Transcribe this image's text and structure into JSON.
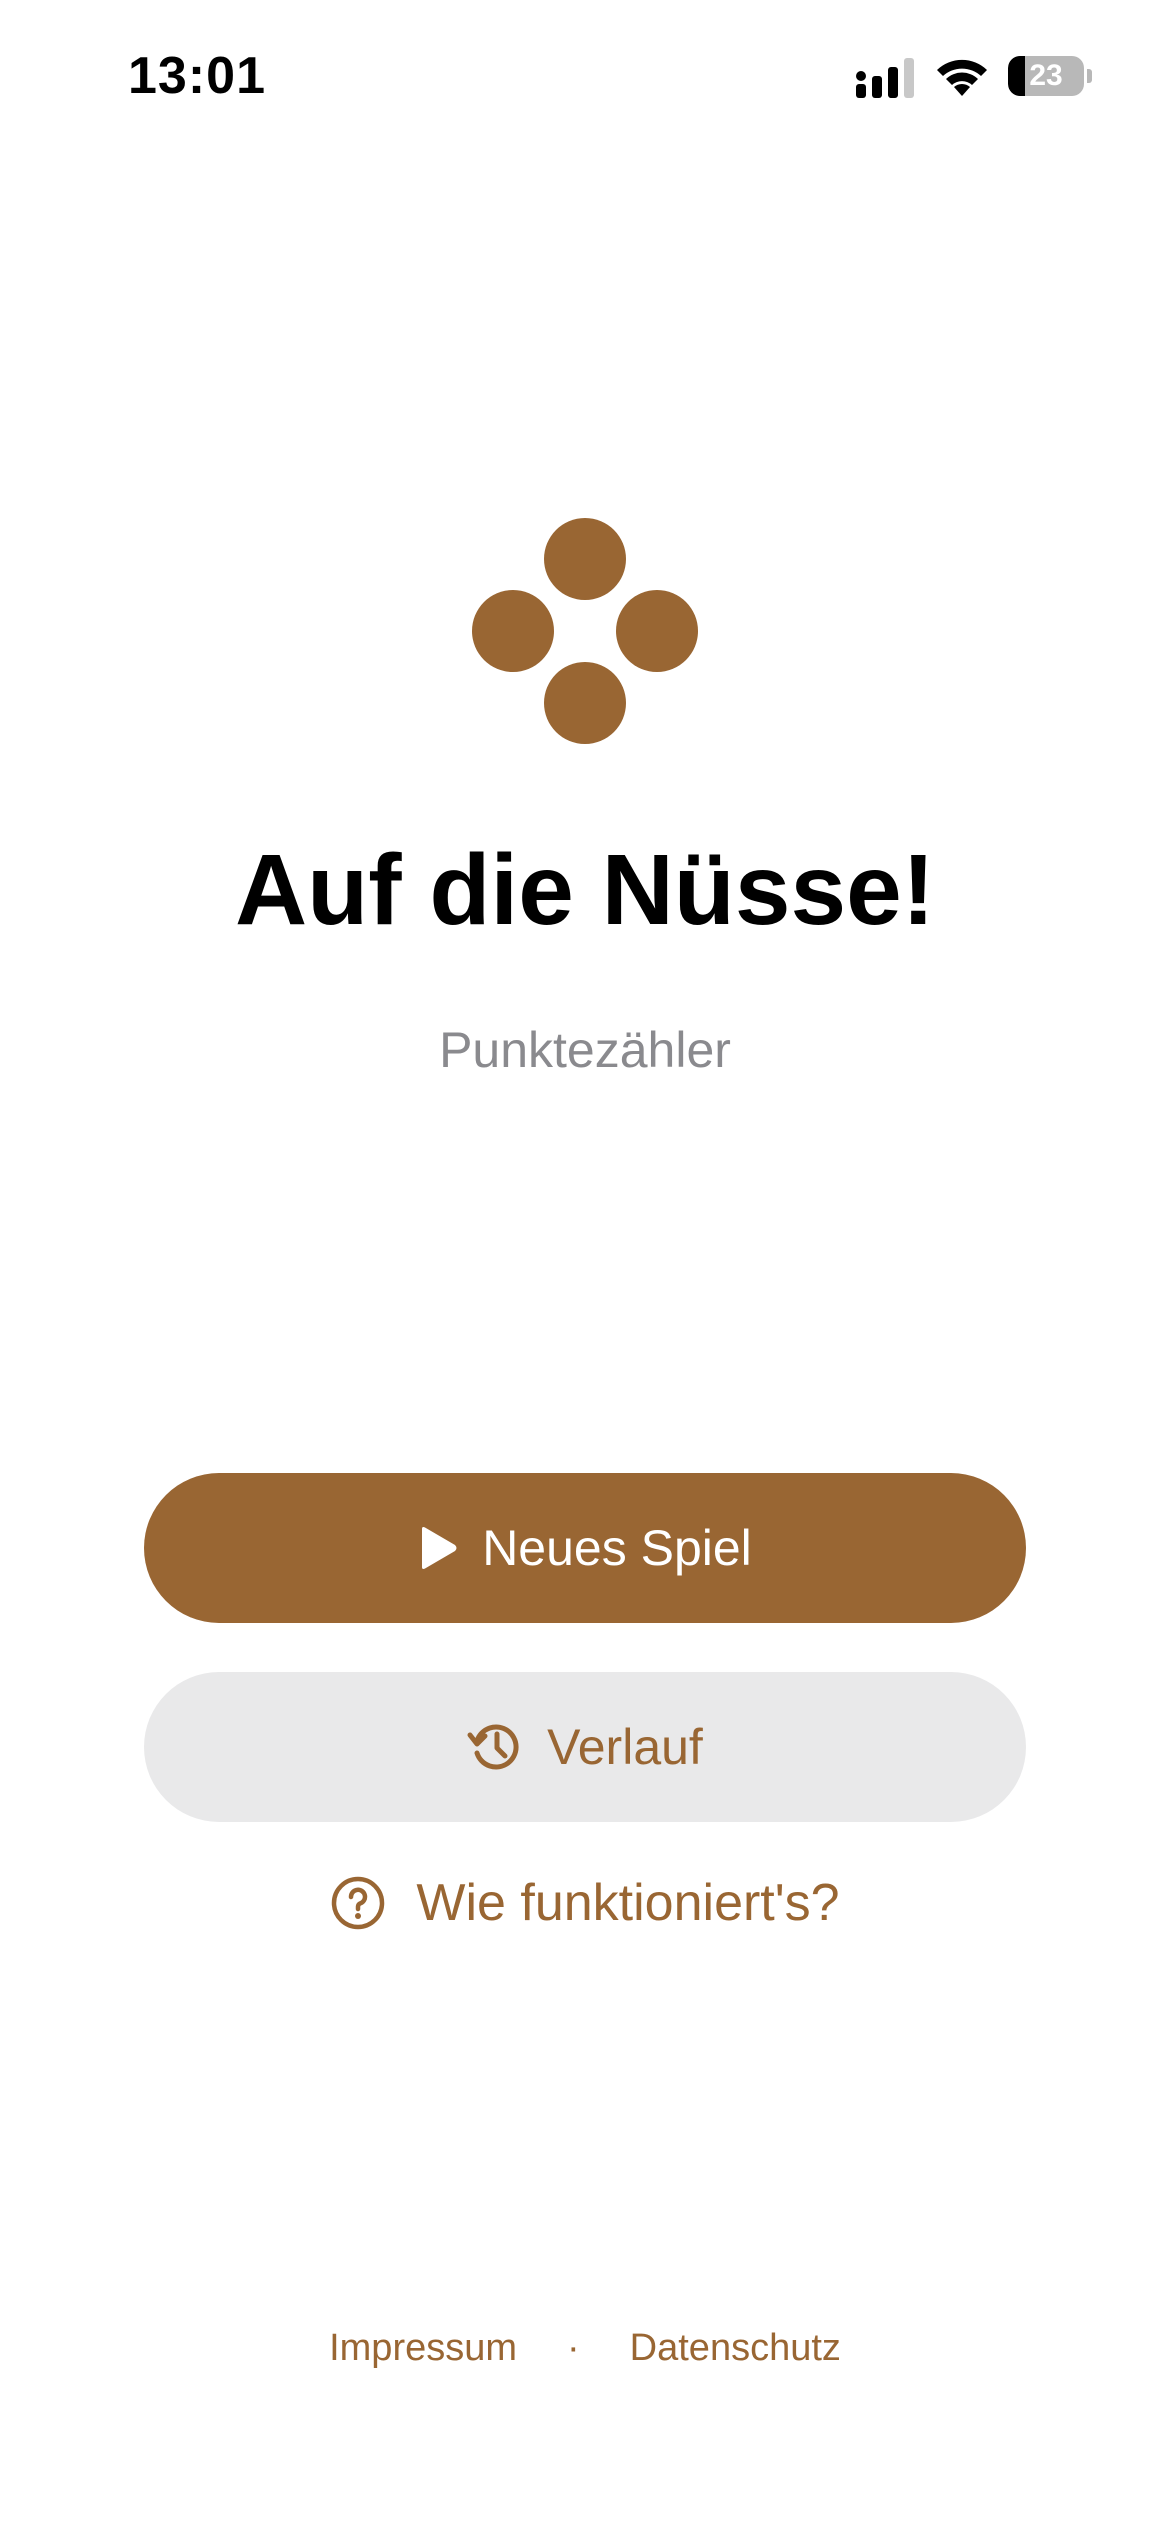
{
  "status_bar": {
    "time": "13:01",
    "battery_level": "23",
    "battery_fraction": 0.23,
    "icons": [
      "signal-icon",
      "wifi-icon",
      "battery-icon"
    ]
  },
  "colors": {
    "accent": "#996633",
    "secondary_bg": "#e9e9ea",
    "subtitle": "#8a8a8e"
  },
  "header": {
    "logo_icon": "four-dots-logo-icon",
    "title": "Auf die Nüsse!",
    "subtitle": "Punktezähler"
  },
  "actions": {
    "new_game": {
      "label": "Neues Spiel",
      "icon": "play-icon"
    },
    "history": {
      "label": "Verlauf",
      "icon": "history-icon"
    },
    "help": {
      "label": "Wie funktioniert's?",
      "icon": "question-circle-icon"
    }
  },
  "footer": {
    "impressum": "Impressum",
    "separator": "·",
    "privacy": "Datenschutz"
  }
}
